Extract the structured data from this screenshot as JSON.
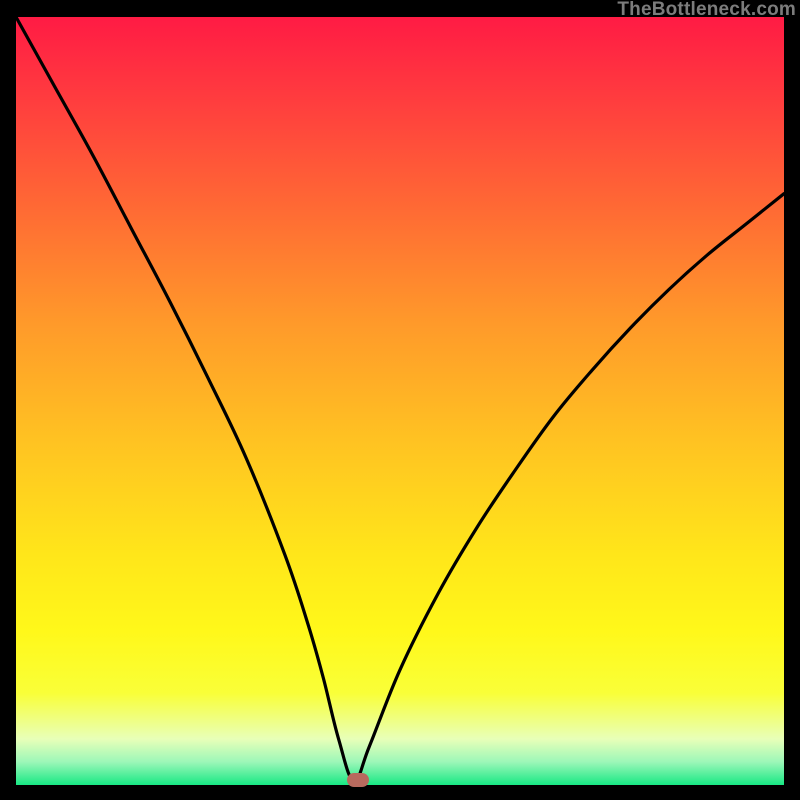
{
  "watermark": "TheBottleneck.com",
  "marker": {
    "color": "#b86a5e",
    "x_pct": 44.5,
    "y_pct": 99.3
  },
  "chart_data": {
    "type": "line",
    "title": "",
    "xlabel": "",
    "ylabel": "",
    "xlim": [
      0,
      100
    ],
    "ylim": [
      0,
      100
    ],
    "grid": false,
    "legend": false,
    "note": "V-shaped curve on red→green vertical gradient. Minimum near x≈44, y≈0. Left branch starts at (0,100).",
    "series": [
      {
        "name": "curve",
        "x": [
          0,
          5,
          10,
          15,
          20,
          25,
          30,
          35,
          38,
          40,
          42,
          44,
          46,
          50,
          55,
          60,
          65,
          70,
          75,
          80,
          85,
          90,
          95,
          100
        ],
        "y": [
          100,
          91,
          82,
          72.5,
          63,
          53,
          42.5,
          30,
          21,
          14,
          6,
          0.5,
          5,
          15,
          25,
          33.5,
          41,
          48,
          54,
          59.5,
          64.5,
          69,
          73,
          77
        ]
      }
    ],
    "background_gradient_top_to_bottom": [
      "#ff1b44",
      "#ff6a34",
      "#ffc222",
      "#fff81a",
      "#18e884"
    ],
    "marker_point": {
      "x": 44.5,
      "y": 0.7,
      "color": "#b86a5e",
      "shape": "rounded-rect"
    }
  }
}
